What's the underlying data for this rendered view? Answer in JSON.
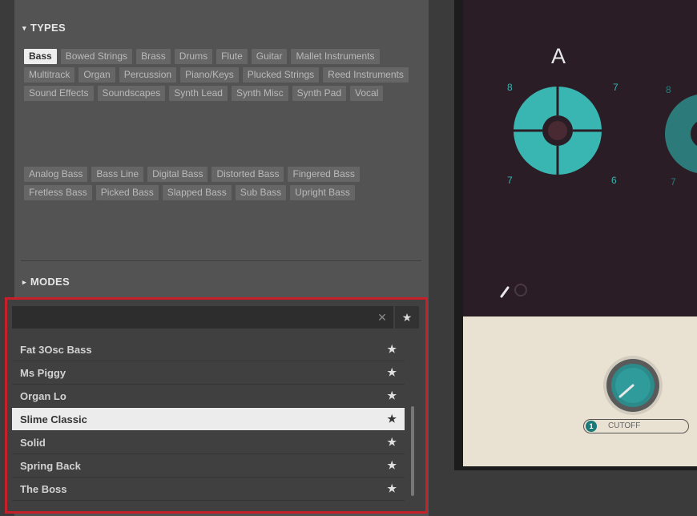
{
  "types": {
    "heading": "TYPES",
    "tags": [
      "Bass",
      "Bowed Strings",
      "Brass",
      "Drums",
      "Flute",
      "Guitar",
      "Mallet Instruments",
      "Multitrack",
      "Organ",
      "Percussion",
      "Piano/Keys",
      "Plucked Strings",
      "Reed Instruments",
      "Sound Effects",
      "Soundscapes",
      "Synth Lead",
      "Synth Misc",
      "Synth Pad",
      "Vocal"
    ],
    "selected_tag": "Bass",
    "subtypes": [
      "Analog Bass",
      "Bass Line",
      "Digital Bass",
      "Distorted Bass",
      "Fingered Bass",
      "Fretless Bass",
      "Picked Bass",
      "Slapped Bass",
      "Sub Bass",
      "Upright Bass"
    ]
  },
  "modes": {
    "heading": "MODES"
  },
  "search": {
    "placeholder": "",
    "clear_glyph": "✕",
    "favorites_glyph": "★"
  },
  "results": {
    "items": [
      {
        "name": "Fat 3Osc Bass",
        "selected": false
      },
      {
        "name": "Ms Piggy",
        "selected": false
      },
      {
        "name": "Organ Lo",
        "selected": false
      },
      {
        "name": "Slime Classic",
        "selected": true
      },
      {
        "name": "Solid",
        "selected": false
      },
      {
        "name": "Spring Back",
        "selected": false
      },
      {
        "name": "The Boss",
        "selected": false
      }
    ],
    "star_glyph": "★"
  },
  "instrument": {
    "section_label": "A",
    "numbers": {
      "top_left": "8",
      "top_right": "7",
      "bottom_left": "7",
      "bottom_right": "6",
      "peek_top": "8",
      "peek_bottom": "7"
    },
    "knob_label": "CUTOFF",
    "knob_badge": "1"
  },
  "colors": {
    "accent": "#39b5b2",
    "highlight_border": "#c8202b",
    "panel": "#535353"
  }
}
